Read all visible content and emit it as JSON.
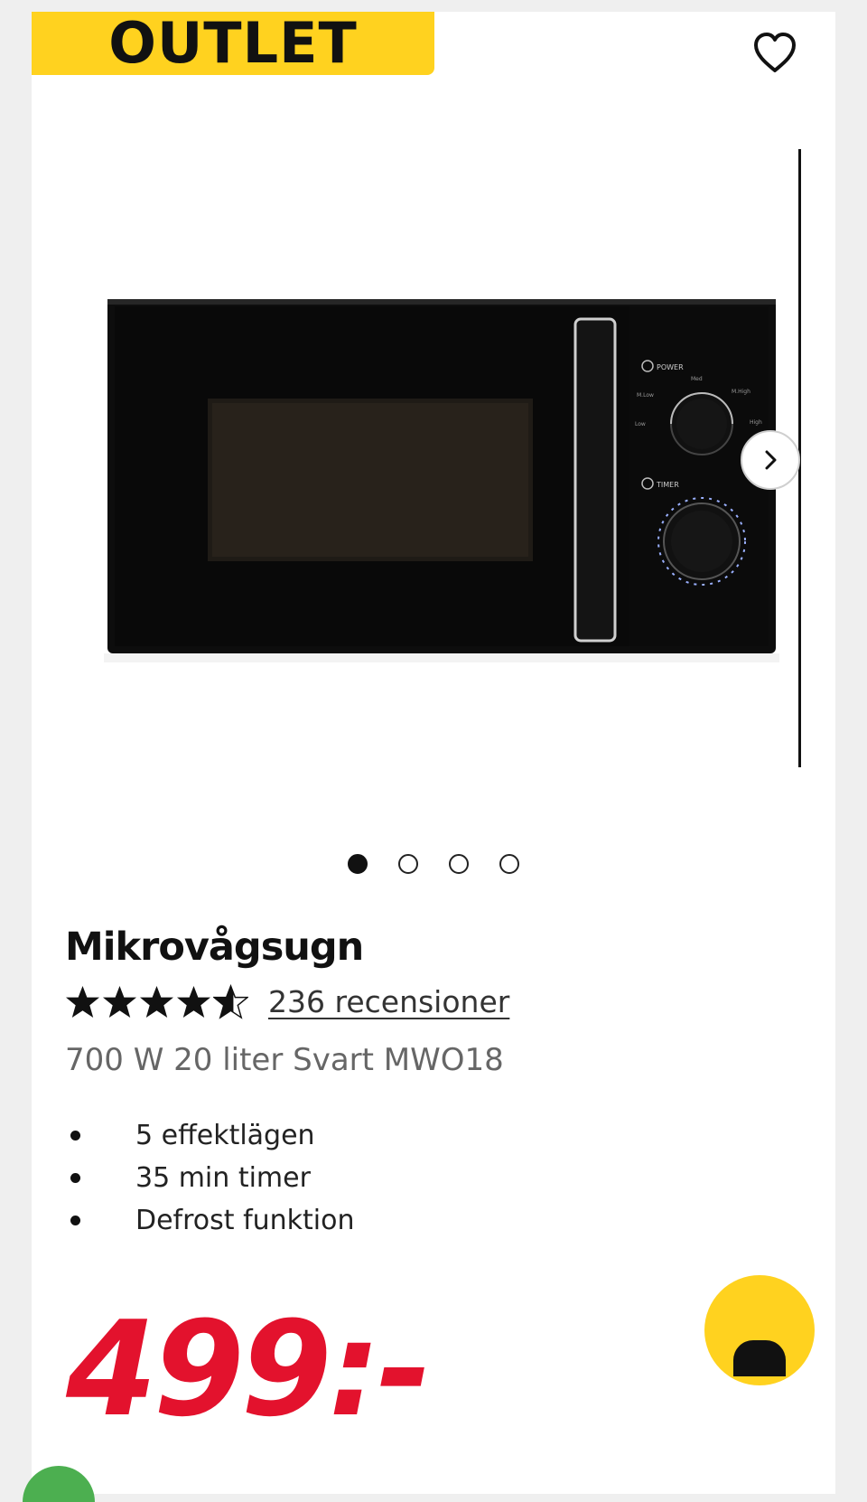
{
  "badge": {
    "label": "OUTLET",
    "color": "#ffd21f"
  },
  "favorite": {
    "icon": "heart-outline-icon"
  },
  "gallery": {
    "next_icon": "chevron-right-icon",
    "image_count": 4,
    "active_index": 0
  },
  "product": {
    "title": "Mikrovågsugn",
    "rating": 4.5,
    "reviews_label": "236 recensioner",
    "subtitle": "700 W 20 liter Svart MWO18",
    "features": [
      "5 effektlägen",
      "35 min timer",
      "Defrost funktion"
    ],
    "price": "499:-",
    "price_color": "#e3122d"
  },
  "microwave_panel": {
    "power_label": "POWER",
    "timer_label": "TIMER",
    "power_levels": [
      "Low",
      "M.Low",
      "Med",
      "M.High",
      "High"
    ]
  },
  "cart": {
    "icon": "cart-icon",
    "color": "#ffd21f"
  }
}
